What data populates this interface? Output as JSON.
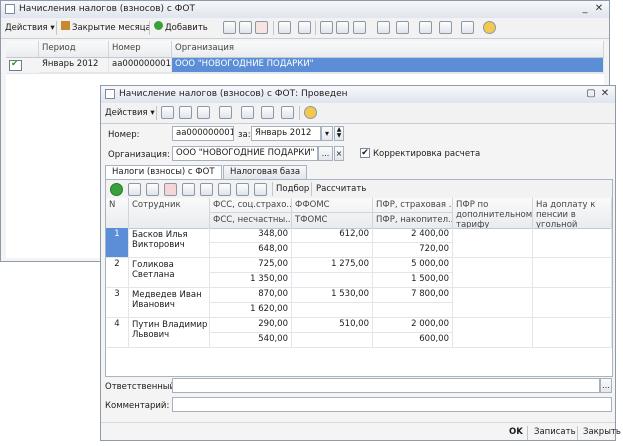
{
  "bg_window": {
    "title": "Начисления налогов (взносов) с ФОТ",
    "toolbar": {
      "actions": "Действия",
      "close_month": "Закрытие месяца",
      "add": "Добавить"
    },
    "columns": [
      "Период",
      "Номер",
      "Организация"
    ],
    "rows": [
      {
        "period": "Январь 2012",
        "number": "аа000000001",
        "org": "ООО \"НОВОГОДНИЕ ПОДАРКИ\""
      }
    ]
  },
  "doc_window": {
    "title": "Начисление налогов (взносов) с ФОТ: Проведен",
    "toolbar": {
      "actions": "Действия"
    },
    "number_label": "Номер:",
    "number_value": "аа000000001",
    "for_label": "за:",
    "period_value": "Январь 2012",
    "org_label": "Организация:",
    "org_value": "ООО \"НОВОГОДНИЕ ПОДАРКИ\"",
    "correction_label": "Корректировка расчета",
    "correction_checked": true,
    "tabs": [
      "Налоги (взносы) с ФОТ",
      "Налоговая база"
    ],
    "grid_toolbar": {
      "selection": "Подбор",
      "calculate": "Рассчитать"
    },
    "headers": {
      "n": "N",
      "employee": "Сотрудник",
      "fss1": "ФСС, соц.страхо...",
      "fss2": "ФСС, несчастны...",
      "ffoms": "ФФОМС",
      "tfoms": "ТФОМС",
      "pfr1": "ПФР, страховая ...",
      "pfr2": "ПФР, накопител...",
      "pfr_add": "ПФР по дополнительному тарифу",
      "pension": "На доплату к пенсии в угольной промышленности"
    },
    "rows": [
      {
        "n": "1",
        "name1": "Басков Илья",
        "name2": "Викторович",
        "fss1": "348,00",
        "fss2": "648,00",
        "ffoms": "612,00",
        "tfoms": "",
        "pfr1": "2 400,00",
        "pfr2": "720,00"
      },
      {
        "n": "2",
        "name1": "Голикова",
        "name2": "Светлана",
        "fss1": "725,00",
        "fss2": "1 350,00",
        "ffoms": "1 275,00",
        "tfoms": "",
        "pfr1": "5 000,00",
        "pfr2": "1 500,00"
      },
      {
        "n": "3",
        "name1": "Медведев Иван",
        "name2": "Иванович",
        "fss1": "870,00",
        "fss2": "1 620,00",
        "ffoms": "1 530,00",
        "tfoms": "",
        "pfr1": "7 800,00",
        "pfr2": ""
      },
      {
        "n": "4",
        "name1": "Путин Владимир",
        "name2": "Львович",
        "fss1": "290,00",
        "fss2": "540,00",
        "ffoms": "510,00",
        "tfoms": "",
        "pfr1": "2 000,00",
        "pfr2": "600,00"
      }
    ],
    "responsible_label": "Ответственный:",
    "comment_label": "Комментарий:",
    "footer": {
      "ok": "OK",
      "save": "Записать",
      "close": "Закрыть"
    }
  },
  "colors": {
    "selection": "#5b8ed6",
    "accent_green": "#3aa03a",
    "title_gradient_top": "#f6f8fb"
  }
}
